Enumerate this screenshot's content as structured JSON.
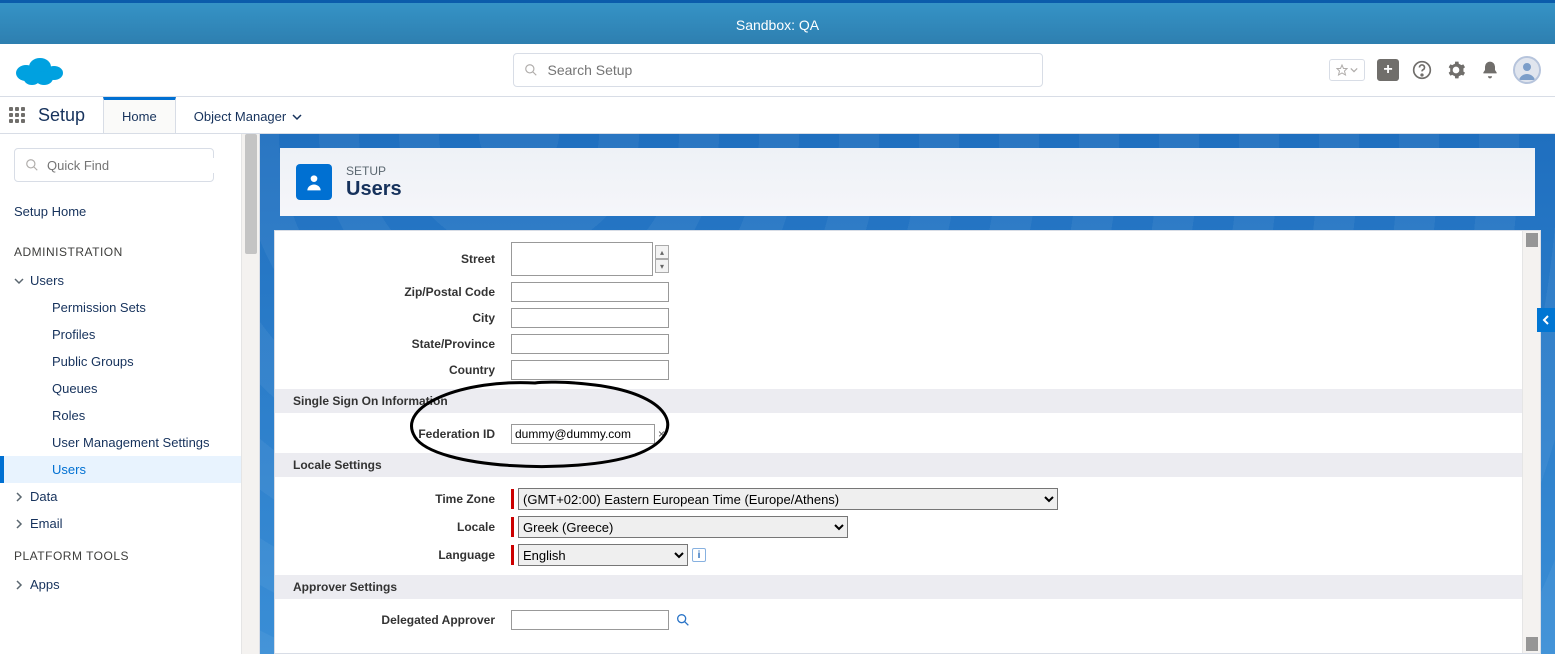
{
  "sandbox_banner": "Sandbox: QA",
  "search": {
    "placeholder": "Search Setup"
  },
  "context": {
    "app": "Setup",
    "tabs": [
      {
        "label": "Home",
        "active": true
      },
      {
        "label": "Object Manager",
        "active": false,
        "hasMenu": true
      }
    ]
  },
  "sidebar": {
    "quickfind_placeholder": "Quick Find",
    "setup_home": "Setup Home",
    "sections": [
      {
        "label": "ADMINISTRATION",
        "items": [
          {
            "label": "Users",
            "expanded": true,
            "children": [
              {
                "label": "Permission Sets"
              },
              {
                "label": "Profiles"
              },
              {
                "label": "Public Groups"
              },
              {
                "label": "Queues"
              },
              {
                "label": "Roles"
              },
              {
                "label": "User Management Settings"
              },
              {
                "label": "Users",
                "active": true
              }
            ]
          },
          {
            "label": "Data",
            "expanded": false
          },
          {
            "label": "Email",
            "expanded": false
          }
        ]
      },
      {
        "label": "PLATFORM TOOLS",
        "items": [
          {
            "label": "Apps",
            "expanded": false
          }
        ]
      }
    ]
  },
  "page_header": {
    "crumb": "SETUP",
    "title": "Users"
  },
  "form": {
    "address": {
      "labels": {
        "street": "Street",
        "zip": "Zip/Postal Code",
        "city": "City",
        "state": "State/Province",
        "country": "Country"
      },
      "values": {
        "street": "",
        "zip": "",
        "city": "",
        "state": "",
        "country": ""
      }
    },
    "sso": {
      "section": "Single Sign On Information",
      "fed_label": "Federation ID",
      "fed_value": "dummy@dummy.com"
    },
    "locale": {
      "section": "Locale Settings",
      "tz_label": "Time Zone",
      "tz_value": "(GMT+02:00) Eastern European Time (Europe/Athens)",
      "loc_label": "Locale",
      "loc_value": "Greek (Greece)",
      "lang_label": "Language",
      "lang_value": "English"
    },
    "approver": {
      "section": "Approver Settings",
      "delegated_label": "Delegated Approver",
      "delegated_value": ""
    }
  }
}
